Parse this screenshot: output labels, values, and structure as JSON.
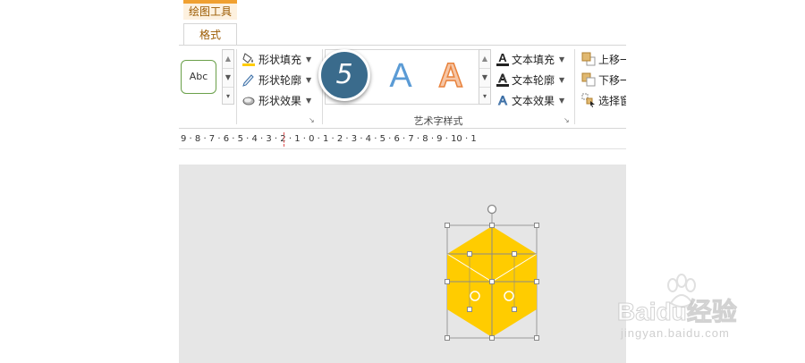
{
  "contextual_tab_group": "绘图工具",
  "active_tab": "格式",
  "shape_styles": {
    "preview_label": "Abc",
    "fill_label": "形状填充",
    "outline_label": "形状轮廓",
    "effects_label": "形状效果"
  },
  "wordart": {
    "step_number": "5",
    "sample_letter_1": "A",
    "sample_letter_2": "A",
    "group_label": "艺术字样式",
    "text_fill_label": "文本填充",
    "text_outline_label": "文本轮廓",
    "text_effects_label": "文本效果"
  },
  "arrange": {
    "bring_forward_label": "上移一",
    "send_backward_label": "下移一",
    "selection_pane_label": "选择窗"
  },
  "ruler_text": "9 · 8 · 7 · 6 · 5 · 4 · 3 · 2 · 1 · 0 · 1 · 2 · 3 · 4 · 5 · 6 · 7 · 8 · 9 · 10 · 1",
  "watermark": {
    "brand": "Baidu经验",
    "url": "jingyan.baidu.com"
  },
  "colors": {
    "hexagon_fill": "#FFCC00",
    "step_badge": "#3a6b8c",
    "accent_tab": "#f0a030",
    "canvas_bg": "#e6e6e6"
  }
}
